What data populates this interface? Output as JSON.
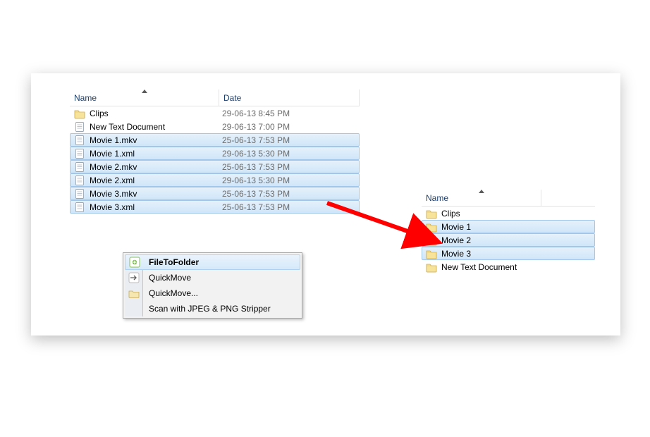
{
  "leftPane": {
    "headers": {
      "name": "Name",
      "date": "Date"
    },
    "rows": [
      {
        "icon": "folder",
        "name": "Clips",
        "date": "29-06-13 8:45 PM",
        "selected": false
      },
      {
        "icon": "doc",
        "name": "New Text Document",
        "date": "29-06-13 7:00 PM",
        "selected": false
      },
      {
        "icon": "doc",
        "name": "Movie 1.mkv",
        "date": "25-06-13 7:53 PM",
        "selected": true
      },
      {
        "icon": "doc",
        "name": "Movie 1.xml",
        "date": "29-06-13 5:30 PM",
        "selected": true
      },
      {
        "icon": "doc",
        "name": "Movie 2.mkv",
        "date": "25-06-13 7:53 PM",
        "selected": true
      },
      {
        "icon": "doc",
        "name": "Movie 2.xml",
        "date": "29-06-13 5:30 PM",
        "selected": true
      },
      {
        "icon": "doc",
        "name": "Movie 3.mkv",
        "date": "25-06-13 7:53 PM",
        "selected": true
      },
      {
        "icon": "doc",
        "name": "Movie 3.xml",
        "date": "25-06-13 7:53 PM",
        "selected": true
      }
    ]
  },
  "rightPane": {
    "headers": {
      "name": "Name"
    },
    "rows": [
      {
        "icon": "folder",
        "name": "Clips",
        "selected": false
      },
      {
        "icon": "folder",
        "name": "Movie 1",
        "selected": true
      },
      {
        "icon": "folder",
        "name": "Movie 2",
        "selected": true
      },
      {
        "icon": "folder",
        "name": "Movie 3",
        "selected": true
      },
      {
        "icon": "folder",
        "name": "New Text Document",
        "selected": false
      }
    ]
  },
  "contextMenu": {
    "items": [
      {
        "label": "FileToFolder",
        "icon": "filetofolder",
        "hover": true
      },
      {
        "label": "QuickMove",
        "icon": "arrow",
        "hover": false
      },
      {
        "label": "QuickMove...",
        "icon": "folderopen",
        "hover": false
      },
      {
        "label": "Scan with JPEG & PNG Stripper",
        "icon": "",
        "hover": false
      }
    ]
  }
}
